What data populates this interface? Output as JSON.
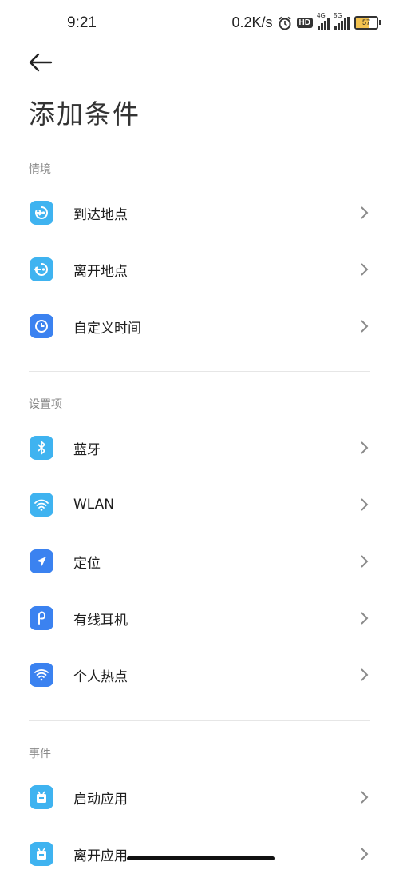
{
  "status": {
    "time": "9:21",
    "net_speed": "0.2K/s",
    "hd_badge": "HD",
    "sig1_label": "4G",
    "sig2_label": "5G",
    "battery": "57"
  },
  "header": {
    "title": "添加条件"
  },
  "sections": {
    "scene": {
      "label": "情境",
      "items": [
        {
          "label": "到达地点",
          "icon": "location-arrive-icon",
          "color": "#3fb3f0"
        },
        {
          "label": "离开地点",
          "icon": "location-leave-icon",
          "color": "#3fb3f0"
        },
        {
          "label": "自定义时间",
          "icon": "clock-icon",
          "color": "#3b82f0"
        }
      ]
    },
    "settings": {
      "label": "设置项",
      "items": [
        {
          "label": "蓝牙",
          "icon": "bluetooth-icon",
          "color": "#3fb3f0"
        },
        {
          "label": "WLAN",
          "icon": "wifi-icon",
          "color": "#3fb3f0"
        },
        {
          "label": "定位",
          "icon": "navigation-icon",
          "color": "#3b82f0"
        },
        {
          "label": "有线耳机",
          "icon": "headphone-icon",
          "color": "#3b82f0"
        },
        {
          "label": "个人热点",
          "icon": "hotspot-icon",
          "color": "#3b82f0"
        }
      ]
    },
    "events": {
      "label": "事件",
      "items": [
        {
          "label": "启动应用",
          "icon": "app-launch-icon",
          "color": "#3fb3f0"
        },
        {
          "label": "离开应用",
          "icon": "app-leave-icon",
          "color": "#3fb3f0"
        }
      ]
    }
  }
}
